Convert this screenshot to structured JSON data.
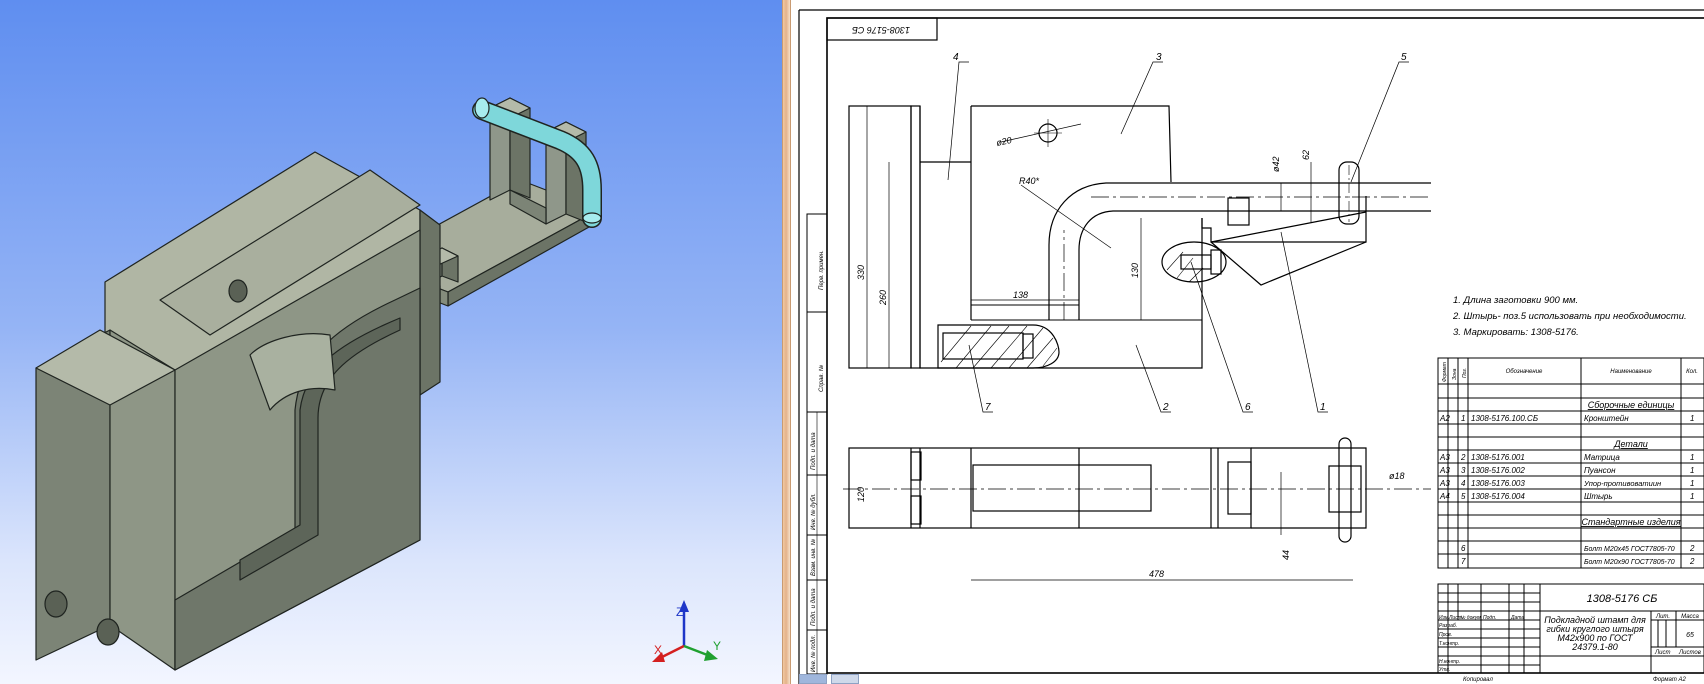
{
  "viewport": {
    "triad": {
      "z_label": "Z",
      "x_label": "X",
      "y_label": "Y"
    },
    "colors": {
      "body": "#8a9482",
      "edge": "#1f2420",
      "rod": "#7ed7da"
    }
  },
  "drawing": {
    "top_stamp": "1308-5176 СБ",
    "positions": [
      "4",
      "3",
      "5",
      "7",
      "2",
      "6",
      "1"
    ],
    "dims": {
      "d20": "ø20",
      "r40": "R40*",
      "d42": "ø42",
      "d62": "62",
      "d330": "330",
      "d260": "260",
      "d138": "138",
      "d130": "130",
      "d120": "120",
      "d18": "ø18",
      "d44": "44",
      "d478": "478"
    },
    "notes": [
      "1. Длина заготовки 900 мм.",
      "2. Штырь- поз.5  использовать при необходимости.",
      "3. Маркировать: 1308-5176."
    ],
    "left_stamp": [
      "Перв. примен.",
      "Справ. №",
      "Подп. и дата",
      "Инв. № дубл.",
      "Взам. инв. №",
      "Подп. и дата",
      "Инв. № подл."
    ],
    "spec": {
      "headers": [
        "Формат",
        "Зона",
        "Поз.",
        "Обозначение",
        "Наименование",
        "Кол."
      ],
      "sections": {
        "assembly": "Сборочные единицы",
        "parts": "Детали",
        "standard": "Стандартные изделия"
      },
      "rows": [
        {
          "fmt": "А2",
          "pos": "1",
          "code": "1308-5176.100.СБ",
          "name": "Кронштейн",
          "qty": "1"
        },
        {
          "fmt": "А3",
          "pos": "2",
          "code": "1308-5176.001",
          "name": "Матрица",
          "qty": "1"
        },
        {
          "fmt": "А3",
          "pos": "3",
          "code": "1308-5176.002",
          "name": "Пуансон",
          "qty": "1"
        },
        {
          "fmt": "А3",
          "pos": "4",
          "code": "1308-5176.003",
          "name": "Упор-противоватиин",
          "qty": "1"
        },
        {
          "fmt": "А4",
          "pos": "5",
          "code": "1308-5176.004",
          "name": "Штырь",
          "qty": "1"
        },
        {
          "fmt": "",
          "pos": "6",
          "code": "",
          "name": "Болт М20х45 ГОСТ7805-70",
          "qty": "2"
        },
        {
          "fmt": "",
          "pos": "7",
          "code": "",
          "name": "Болт М20х90 ГОСТ7805-70",
          "qty": "2"
        }
      ]
    },
    "title_block": {
      "code": "1308-5176 СБ",
      "name_lines": [
        "Подкладной штамп для",
        "гибки круглого штыря",
        "М42х900 по ГОСТ",
        "24379.1-80"
      ],
      "col_labels": [
        "Лит.",
        "Масса",
        "Масштаб"
      ],
      "mass": "65",
      "sheet_label": "Лист",
      "sheets_label": "Листов",
      "rows_labels": [
        "Изм.",
        "Лист",
        "№ докум.",
        "Подп.",
        "Дата",
        "Разраб.",
        "Пров.",
        "Т.контр.",
        "Н.контр.",
        "Утв."
      ],
      "copied": "Копировал",
      "format": "Формат   А2"
    }
  }
}
